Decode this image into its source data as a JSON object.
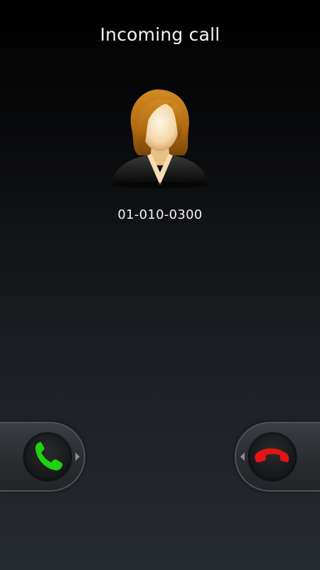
{
  "screen": {
    "title": "Incoming call",
    "caller_number": "01-010-0300"
  },
  "answer_tab": {
    "icon": "phone-answer-icon",
    "color": "#1ed40f",
    "arrow_icon": "arrow-right-icon"
  },
  "decline_tab": {
    "icon": "phone-decline-icon",
    "color": "#e31414",
    "arrow_icon": "arrow-left-icon"
  },
  "avatar": {
    "icon": "female-contact-avatar"
  }
}
